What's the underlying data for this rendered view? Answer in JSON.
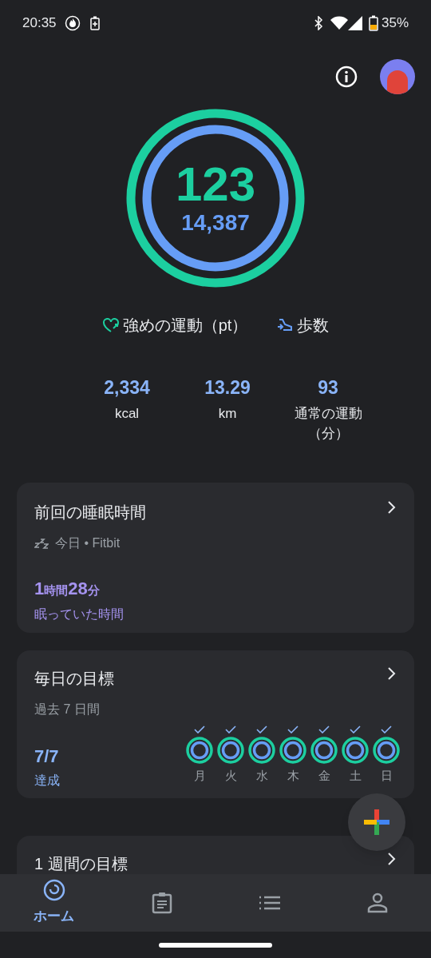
{
  "status_bar": {
    "time": "20:35",
    "battery": "35%"
  },
  "rings": {
    "heart_points": "123",
    "steps": "14,387",
    "outer": {
      "level": 1
    },
    "inner": {
      "level": 1
    }
  },
  "legend": [
    {
      "kind": "heart",
      "label": "強めの運動（pt）"
    },
    {
      "kind": "steps",
      "label": "歩数"
    }
  ],
  "stats": [
    {
      "value": "2,334",
      "label": "kcal"
    },
    {
      "value": "13.29",
      "label": "km"
    },
    {
      "value": "93",
      "label": "通常の運動（分）"
    }
  ],
  "sleep_card": {
    "title": "前回の睡眠時間",
    "source": "今日 • Fitbit",
    "hours": "1",
    "hours_unit": "時間",
    "minutes": "28",
    "minutes_unit": "分",
    "caption": "眠っていた時間"
  },
  "daily_goals_card": {
    "title": "毎日の目標",
    "subtitle": "過去 7 日間",
    "result": "7/7",
    "result_label": "達成",
    "days": [
      {
        "label": "月",
        "checked": true
      },
      {
        "label": "火",
        "checked": true
      },
      {
        "label": "水",
        "checked": true
      },
      {
        "label": "木",
        "checked": true
      },
      {
        "label": "金",
        "checked": true
      },
      {
        "label": "土",
        "checked": true
      },
      {
        "label": "日",
        "checked": true
      }
    ]
  },
  "weekly_goal_card": {
    "title": "1 週間の目標"
  },
  "nav": [
    {
      "kind": "home",
      "label": "ホーム",
      "selected": true
    },
    {
      "kind": "journal",
      "selected": false
    },
    {
      "kind": "browse",
      "selected": false
    },
    {
      "kind": "profile",
      "selected": false
    }
  ]
}
